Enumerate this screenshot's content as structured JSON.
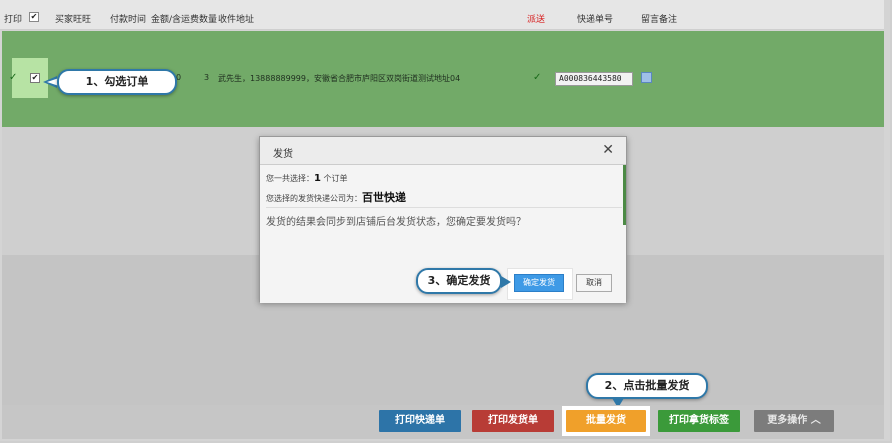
{
  "table_header": {
    "print": "打印",
    "buyer": "买家旺旺",
    "pay_time": "付款时间",
    "amount": "金额/含运费",
    "quantity": "数量",
    "address": "收件地址",
    "shipping": "派送",
    "tracking_no": "快递单号",
    "remark": "留言备注"
  },
  "order_row": {
    "quantity": "3",
    "address": "武先生，13888889999，安徽省合肥市庐阳区双岗街道测试地址04",
    "partial_digit": "0",
    "tracking_no": "A000836443580"
  },
  "dialog": {
    "title": "发货",
    "selected_prefix": "您一共选择：",
    "selected_count": "1",
    "selected_suffix": " 个订单",
    "company_prefix": "您选择的发货快递公司为：",
    "company_name": "百世快递",
    "message": "发货的结果会同步到店铺后台发货状态，您确定要发货吗？",
    "confirm_label": "确定发货",
    "cancel_label": "取消"
  },
  "callouts": {
    "step1": "1、勾选订单",
    "step2": "2、点击批量发货",
    "step3": "3、确定发货"
  },
  "footer": {
    "print_express": "打印快递单",
    "print_ship": "打印发货单",
    "batch_ship": "批量发货",
    "print_label": "打印拿货标签",
    "more": "更多操作"
  },
  "colors": {
    "row_green": "#72aa68",
    "confirm_blue": "#3e9ae6",
    "batch_orange": "#f0a02a",
    "callout_border": "#2f78a8"
  }
}
